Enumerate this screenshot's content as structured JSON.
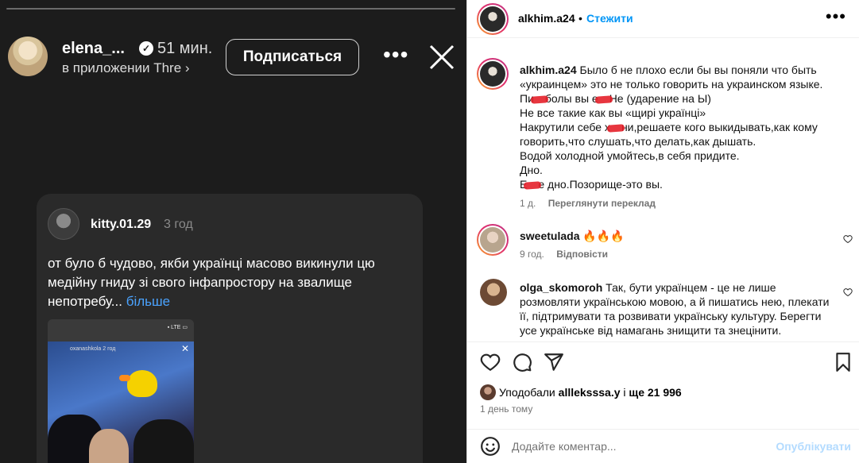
{
  "story": {
    "username": "elena_...",
    "time": "51 мин.",
    "subtitle": "в приложении Thre",
    "subtitle_chevron": "›",
    "subscribe_label": "Подписаться",
    "more_label": "•••",
    "embedded_post": {
      "username": "kitty.01.29",
      "time": "3 год",
      "text": "от було б чудово, якби українці масово викинули цю медійну гниду зі свого інфапростору на звалище непотребу...",
      "more_link": "більше",
      "thumb_status": "▪ LTE ▭",
      "thumb_caption": "oxanashkola  2 год"
    }
  },
  "post": {
    "author": "alkhim.a24",
    "dot": "•",
    "follow_label": "Стежити",
    "more_label": "•••",
    "caption": {
      "username": "alkhim.a24",
      "line1": "Было б не плохо если бы вы поняли что быть «украинцем» это не только говорить на украинском языке.",
      "line2a": "Пи",
      "line2b": "болы вы е",
      "line2c": "Не (ударение на Ы)",
      "line3": "Не все такие как вы «щирі українці»",
      "line4a": "Накрутили себе х",
      "line4b": "ни,решаете кого выкидывать,как кому говорить,что слушать,что делать,как дышать.",
      "line5": "Водой холодной умойтесь,в себя придите.",
      "line6": "Дно.",
      "line7a": "Е",
      "line7b": "е дно.Позорище-это вы.",
      "time": "1 д.",
      "translate": "Переглянути переклад"
    },
    "comments": [
      {
        "username": "sweetulada",
        "text": "🔥🔥🔥",
        "time": "9 год.",
        "reply": "Відповісти"
      },
      {
        "username": "olga_skomoroh",
        "text": "Так, бути українцем - це не лише розмовляти українською мовою, а й пишатись нею, плекати її, підтримувати та розвивати українську культуру. Берегти усе українське від намагань знищити та знецінити."
      }
    ],
    "likes_prefix": "Уподобали ",
    "likes_user": "allleksssa.y",
    "likes_middle": " і ",
    "likes_count": "ще 21 996",
    "posted": "1 день тому",
    "comment_placeholder": "Додайте коментар...",
    "publish_label": "Опублікувати"
  },
  "colors": {
    "accent": "#0095f6",
    "publish_disabled": "#b3dbff",
    "story_bg": "#1c1c1c"
  }
}
